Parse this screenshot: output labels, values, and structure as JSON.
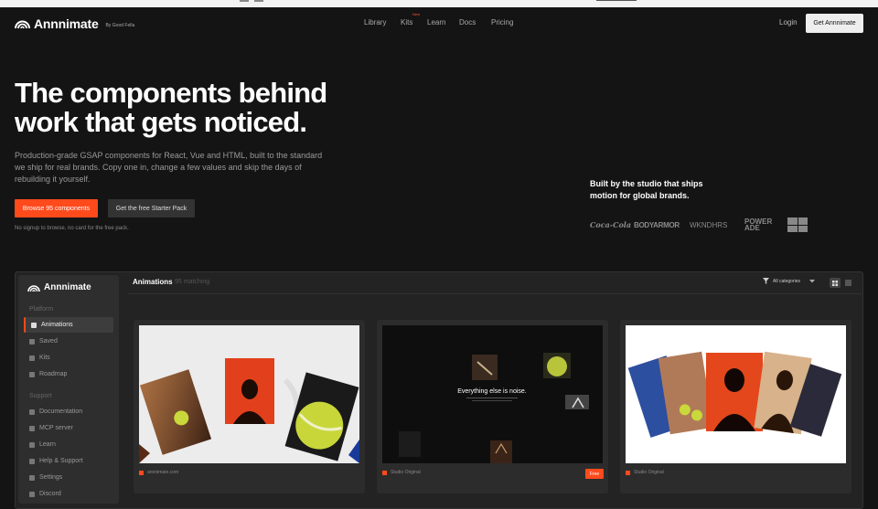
{
  "nav": {
    "logo": "Annnimate",
    "by": "By Good Fella",
    "links": [
      "Library",
      "Kits",
      "Learn",
      "Docs",
      "Pricing"
    ],
    "kits_badge": "New",
    "login": "Login",
    "cta": "Get Annnimate"
  },
  "hero": {
    "title": "The components behind work that gets noticed.",
    "description": "Production-grade GSAP components for React, Vue and HTML, built to the standard we ship for real brands. Copy one in, change a few values and skip the days of rebuilding it yourself.",
    "primary_button": "Browse 95 components",
    "secondary_button": "Get the free Starter Pack",
    "note": "No signup to browse, no card for the free pack.",
    "studio_text": "Built by the studio that ships motion for global brands.",
    "brands": [
      "Coca-Cola",
      "BODYARMOR",
      "WKNDHRS",
      "POWER ADE"
    ]
  },
  "app": {
    "logo": "Annnimate",
    "sections": [
      {
        "label": "Platform",
        "items": [
          "Animations",
          "Saved",
          "Kits",
          "Roadmap"
        ]
      },
      {
        "label": "Support",
        "items": [
          "Documentation",
          "MCP server",
          "Learn",
          "Help & Support",
          "Settings",
          "Discord"
        ]
      }
    ],
    "main_title": "Animations",
    "count": "95 matching",
    "filter": "All categories",
    "cards": [
      {
        "label": "annnimate.com",
        "thumb_text": "",
        "badge": ""
      },
      {
        "label": "Studio Original",
        "thumb_text": "Everything else is noise.",
        "badge": "Free"
      },
      {
        "label": "Studio Original",
        "thumb_text": "",
        "badge": ""
      }
    ]
  },
  "colors": {
    "accent": "#ff4a1c",
    "background": "#141414",
    "panel": "#232323"
  }
}
